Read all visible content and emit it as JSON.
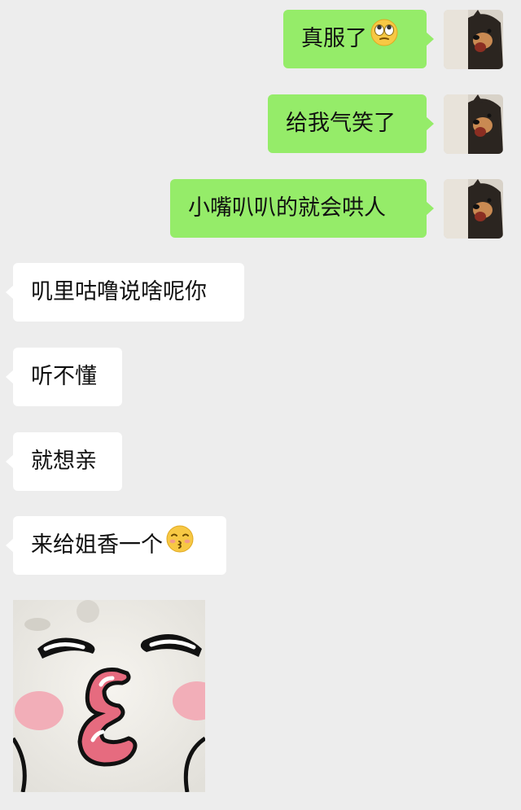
{
  "messages": [
    {
      "side": "out",
      "text": "真服了",
      "emoji": "eye-roll-emoji"
    },
    {
      "side": "out",
      "text": "给我气笑了"
    },
    {
      "side": "out",
      "text": "小嘴叭叭的就会哄人"
    },
    {
      "side": "in",
      "text": "叽里咕噜说啥呢你"
    },
    {
      "side": "in",
      "text": "听不懂"
    },
    {
      "side": "in",
      "text": "就想亲"
    },
    {
      "side": "in",
      "text": "来给姐香一个",
      "emoji": "kissing-emoji"
    }
  ],
  "sticker": {
    "icon": "kissing-face-sticker"
  },
  "colors": {
    "background": "#ededed",
    "outgoing_bubble": "#95ec69",
    "incoming_bubble": "#ffffff"
  }
}
